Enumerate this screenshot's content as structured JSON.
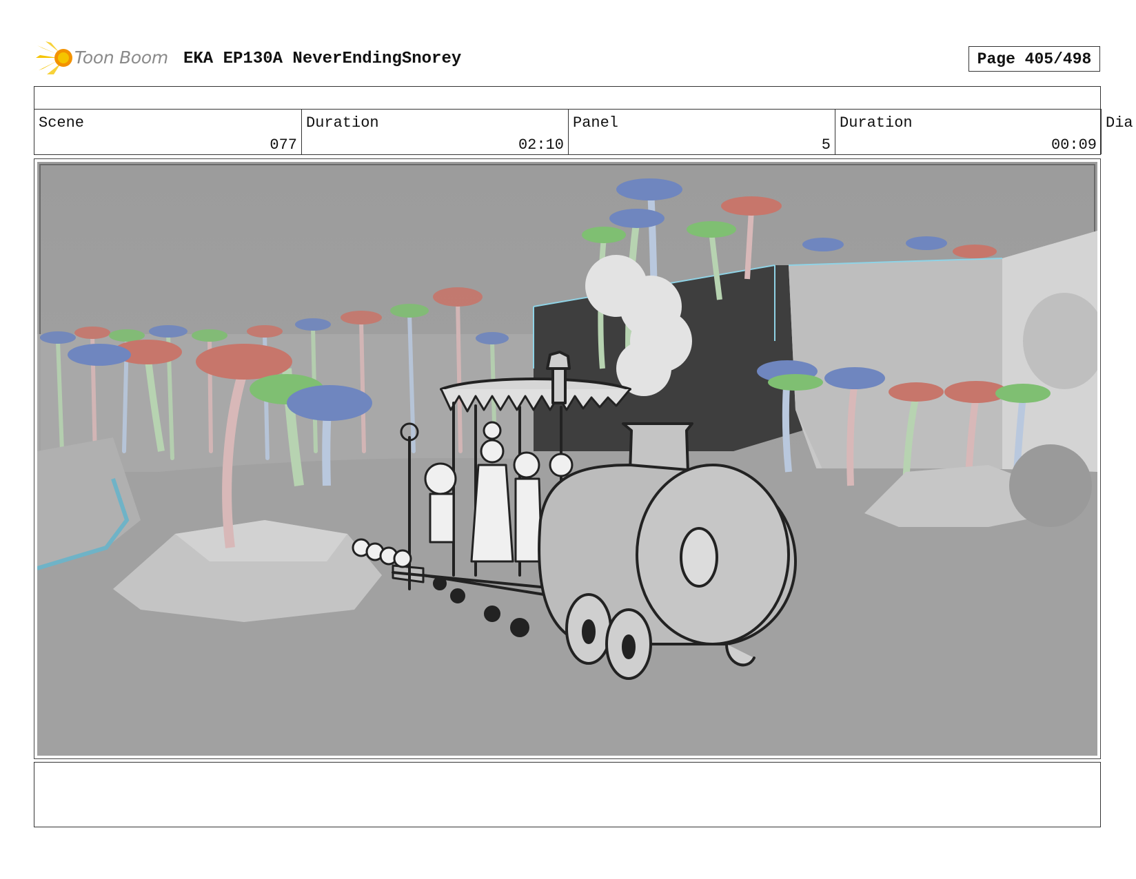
{
  "header": {
    "logo_text": "Toon Boom",
    "project_title": "EKA EP130A NeverEndingSnorey",
    "page_label": "Page 405/498"
  },
  "info": {
    "scene_label": "Scene",
    "scene_value": "077",
    "scene_duration_label": "Duration",
    "scene_duration_value": "02:10",
    "panel_label": "Panel",
    "panel_value": "5",
    "panel_duration_label": "Duration",
    "panel_duration_value": "00:09",
    "dialogue_label_cut": "Dia"
  },
  "colors": {
    "logo_yellow": "#f5c400",
    "logo_orange": "#f39200",
    "background_gray": "#a3a3a3"
  },
  "icons": {
    "logo_mark": "toon-boom-comet-icon"
  }
}
